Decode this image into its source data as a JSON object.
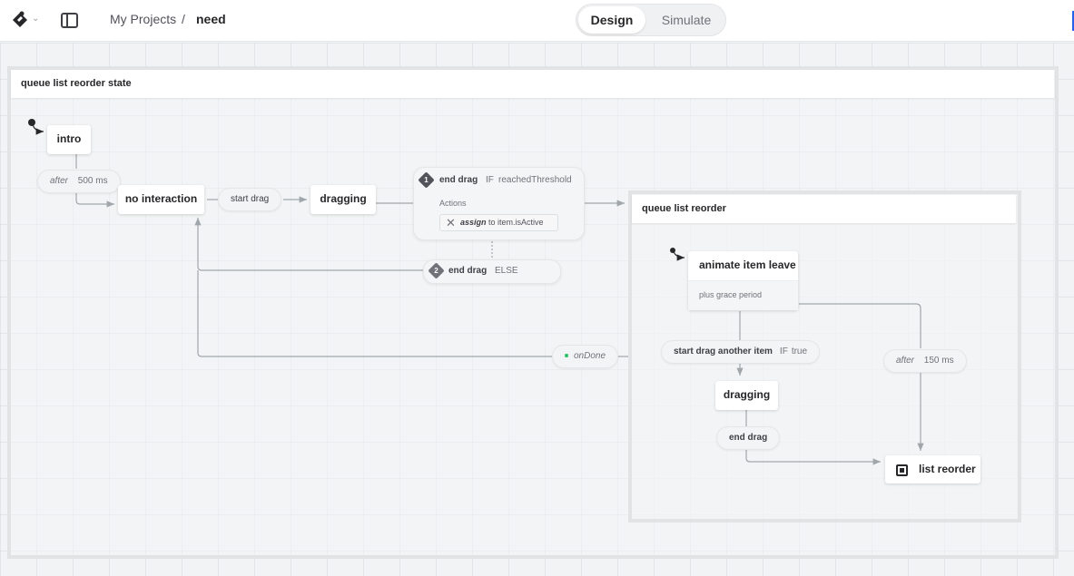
{
  "header": {
    "logo_icon": "statelyai-logo-icon",
    "breadcrumb": {
      "projects": "My Projects",
      "separator": "/",
      "current": "need"
    },
    "mode_toggle": {
      "design": "Design",
      "simulate": "Simulate",
      "active": "Design"
    }
  },
  "machine": {
    "root": {
      "title": "queue list reorder state",
      "states": {
        "intro": "intro",
        "no_interaction": "no interaction",
        "dragging": "dragging"
      },
      "transitions": {
        "after_intro": {
          "prefix": "after",
          "delay": "500 ms"
        },
        "start_drag": "start drag",
        "end_drag_guarded": {
          "index": "1",
          "event": "end drag",
          "keyword": "IF",
          "guard": "reachedThreshold",
          "actions_label": "Actions",
          "action": {
            "icon": "xstate-action-icon",
            "type": "assign",
            "text": "to item.isActive"
          }
        },
        "end_drag_else": {
          "index": "2",
          "event": "end drag",
          "keyword": "ELSE"
        },
        "on_done": "onDone"
      }
    },
    "inner": {
      "title": "queue list reorder",
      "states": {
        "animate": {
          "title": "animate item leave",
          "description": "plus grace period"
        },
        "dragging": "dragging",
        "final": "list reorder"
      },
      "transitions": {
        "start_drag_another": {
          "event": "start drag another item",
          "keyword": "IF",
          "guard": "true"
        },
        "after_150": {
          "prefix": "after",
          "delay": "150 ms"
        },
        "end_drag": "end drag"
      }
    }
  },
  "colors": {
    "accent": "#2563eb",
    "canvas": "#f1f3f4",
    "wire": "#a1a6ab",
    "done_dot": "#22c55e"
  }
}
